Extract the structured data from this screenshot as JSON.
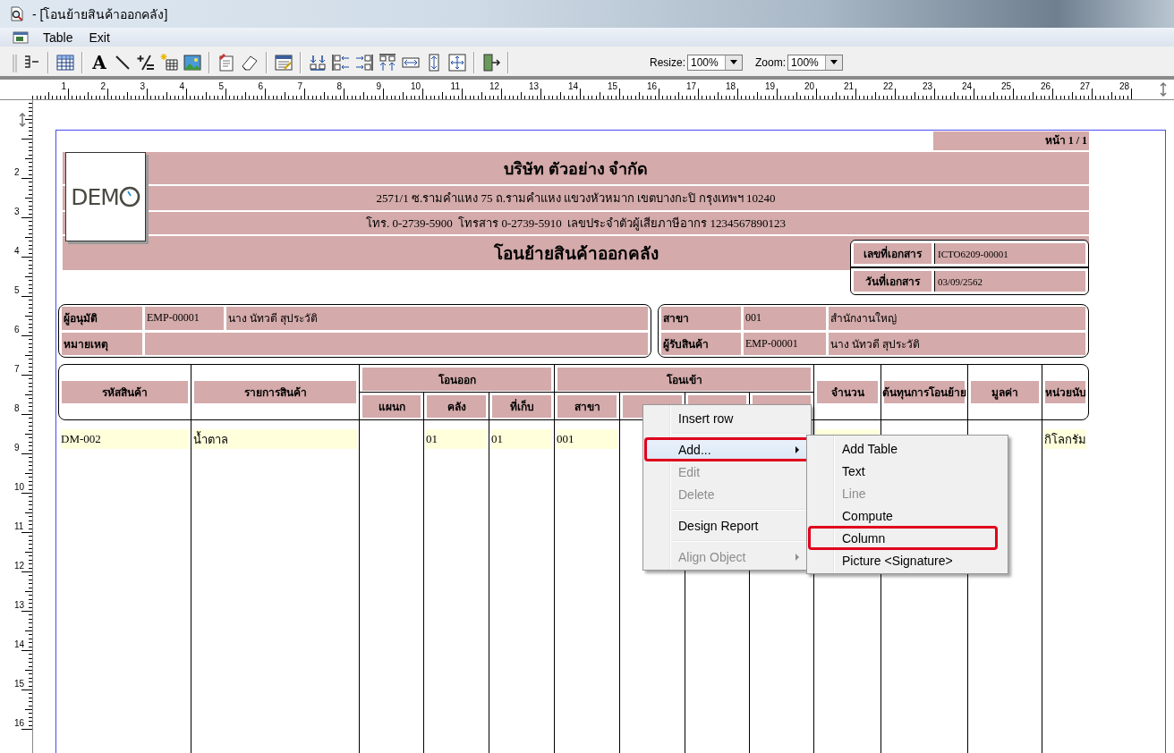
{
  "window": {
    "title": "- [โอนย้ายสินค้าออกคลัง]"
  },
  "menu_bar": {
    "items": [
      "Table",
      "Exit"
    ]
  },
  "toolbar": {
    "buttons": [
      {
        "kind": "grip"
      },
      {
        "kind": "lines"
      },
      {
        "kind": "separator"
      },
      {
        "kind": "grid"
      },
      {
        "kind": "separator"
      },
      {
        "kind": "glyph",
        "text": "A"
      },
      {
        "kind": "line"
      },
      {
        "kind": "formula"
      },
      {
        "kind": "sparkle"
      },
      {
        "kind": "picture"
      },
      {
        "kind": "separator"
      },
      {
        "kind": "clipboard"
      },
      {
        "kind": "eraser"
      },
      {
        "kind": "separator"
      },
      {
        "kind": "window"
      },
      {
        "kind": "separator"
      },
      {
        "kind": "align-bottom"
      },
      {
        "kind": "align-left"
      },
      {
        "kind": "align-right"
      },
      {
        "kind": "align-top"
      },
      {
        "kind": "same-width"
      },
      {
        "kind": "same-height"
      },
      {
        "kind": "center"
      },
      {
        "kind": "separator"
      },
      {
        "kind": "exit"
      },
      {
        "kind": "separator"
      }
    ],
    "resize": {
      "label": "Resize:",
      "value": "100%"
    },
    "zoom": {
      "label": "Zoom:",
      "value": "100%"
    }
  },
  "ruler": {
    "horizontal": [
      "1",
      "2",
      "3",
      "4",
      "5",
      "6",
      "7",
      "8",
      "9",
      "10",
      "11",
      "12",
      "13",
      "14",
      "15",
      "16",
      "17",
      "18",
      "19",
      "20",
      "21",
      "22",
      "23",
      "24",
      "25",
      "26",
      "27",
      "28"
    ],
    "vertical": [
      "2",
      "3",
      "4",
      "5",
      "6",
      "7",
      "8",
      "9",
      "10",
      "11",
      "12",
      "13",
      "14",
      "15",
      "16"
    ]
  },
  "report": {
    "page_label": "หน้า 1 / 1",
    "header": {
      "logo": "DEM",
      "company": "บริษัท ตัวอย่าง จำกัด",
      "address": "2571/1 ซ.รามคำแหง 75 ถ.รามคำแหง แขวงหัวหมาก เขตบางกะปิ กรุงเทพฯ 10240",
      "contact": "โทร. 0-2739-5900  โทรสาร 0-2739-5910  เลขประจำตัวผู้เสียภาษีอากร 1234567890123",
      "title": "โอนย้ายสินค้าออกคลัง"
    },
    "document": [
      {
        "label": "เลขที่เอกสาร",
        "value": "ICTO6209-00001"
      },
      {
        "label": "วันที่เอกสาร",
        "value": "03/09/2562"
      }
    ],
    "approval": [
      {
        "label": "ผู้อนุมัติ",
        "code": "EMP-00001",
        "name": "นาง นัทวดี สุประวัติ"
      },
      {
        "label": "หมายเหตุ"
      }
    ],
    "branch": [
      {
        "label": "สาขา",
        "code": "001",
        "name": "สำนักงานใหญ่"
      },
      {
        "label": "ผู้รับสินค้า",
        "code": "EMP-00001",
        "name": "นาง นัทวดี สุประวัติ"
      }
    ],
    "table": {
      "column_groups": [
        {
          "label": "โอนออก"
        },
        {
          "label": "โอนเข้า"
        }
      ],
      "columns": [
        {
          "label": "รหัสสินค้า"
        },
        {
          "label": "รายการสินค้า"
        },
        {
          "group_start": true,
          "label": "แผนก"
        },
        {
          "in_group": true,
          "label": "คลัง"
        },
        {
          "in_group": true,
          "label": "ที่เก็บ"
        },
        {
          "group_start": true,
          "label": "สาขา"
        },
        {
          "in_group": true
        },
        {
          "in_group": true
        },
        {
          "in_group": true
        },
        {
          "label": "จำนวน"
        },
        {
          "label": "ต้นทุนการโอนย้าย"
        },
        {
          "label": "มูลค่า"
        },
        {
          "label": "หน่วยนับ"
        }
      ],
      "rows": [
        {
          "cells": [
            {
              "text": "DM-002",
              "filled": true
            },
            {
              "text": "น้ำตาล",
              "filled": true
            },
            {
              "text": ""
            },
            {
              "text": "01",
              "filled": true
            },
            {
              "text": "01",
              "filled": true
            },
            {
              "text": "001",
              "filled": true
            },
            {
              "text": ""
            },
            {
              "text": ""
            },
            {
              "text": ""
            },
            {
              "text": "",
              "filled": true
            },
            {
              "text": ""
            },
            {
              "text": ""
            },
            {
              "text": "กิโลกรัม",
              "filled": true
            }
          ]
        }
      ]
    }
  },
  "context_menu": {
    "items": [
      {
        "kind": "item",
        "label": "Insert row",
        "disabled": false,
        "selected": false,
        "submenu": false,
        "highlighted": false
      },
      {
        "kind": "separator"
      },
      {
        "kind": "item",
        "label": "Add...",
        "disabled": false,
        "selected": true,
        "submenu": true,
        "highlighted": true
      },
      {
        "kind": "item",
        "label": "Edit",
        "disabled": true,
        "selected": false,
        "submenu": false,
        "highlighted": false
      },
      {
        "kind": "item",
        "label": "Delete",
        "disabled": true,
        "selected": false,
        "submenu": false,
        "highlighted": false
      },
      {
        "kind": "separator"
      },
      {
        "kind": "item",
        "label": "Design Report",
        "disabled": false,
        "selected": false,
        "submenu": false,
        "highlighted": false
      },
      {
        "kind": "separator"
      },
      {
        "kind": "item",
        "label": "Align Object",
        "disabled": true,
        "selected": false,
        "submenu": true,
        "highlighted": false
      }
    ]
  },
  "submenu": {
    "items": [
      {
        "kind": "item",
        "label": "Add Table",
        "disabled": false,
        "selected": false,
        "submenu": false,
        "highlighted": false
      },
      {
        "kind": "item",
        "label": "Text",
        "disabled": false,
        "selected": false,
        "submenu": false,
        "highlighted": false
      },
      {
        "kind": "item",
        "label": "Line",
        "disabled": true,
        "selected": false,
        "submenu": false,
        "highlighted": false
      },
      {
        "kind": "item",
        "label": "Compute",
        "disabled": false,
        "selected": false,
        "submenu": false,
        "highlighted": false
      },
      {
        "kind": "item",
        "label": "Column",
        "disabled": false,
        "selected": false,
        "submenu": false,
        "highlighted": true
      },
      {
        "kind": "item",
        "label": "Picture <Signature>",
        "disabled": false,
        "selected": false,
        "submenu": false,
        "highlighted": false
      }
    ]
  }
}
